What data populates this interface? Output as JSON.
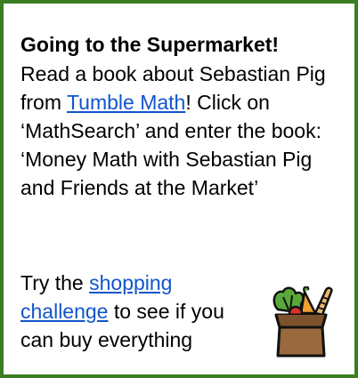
{
  "card": {
    "title": "Going to the Supermarket!",
    "para1": {
      "text_before": "Read a book about Sebastian Pig from ",
      "link": "Tumble Math",
      "text_after": "! Click on ‘MathSearch’ and enter the book: ‘Money Math with Sebastian Pig and Friends at the Market’"
    },
    "para2": {
      "text_before": "Try the ",
      "link": "shopping challenge",
      "text_after": " to see if you can buy everything"
    },
    "image_icon": "grocery-bag-icon",
    "colors": {
      "border": "#3a7d22",
      "link": "#1155cc"
    }
  }
}
